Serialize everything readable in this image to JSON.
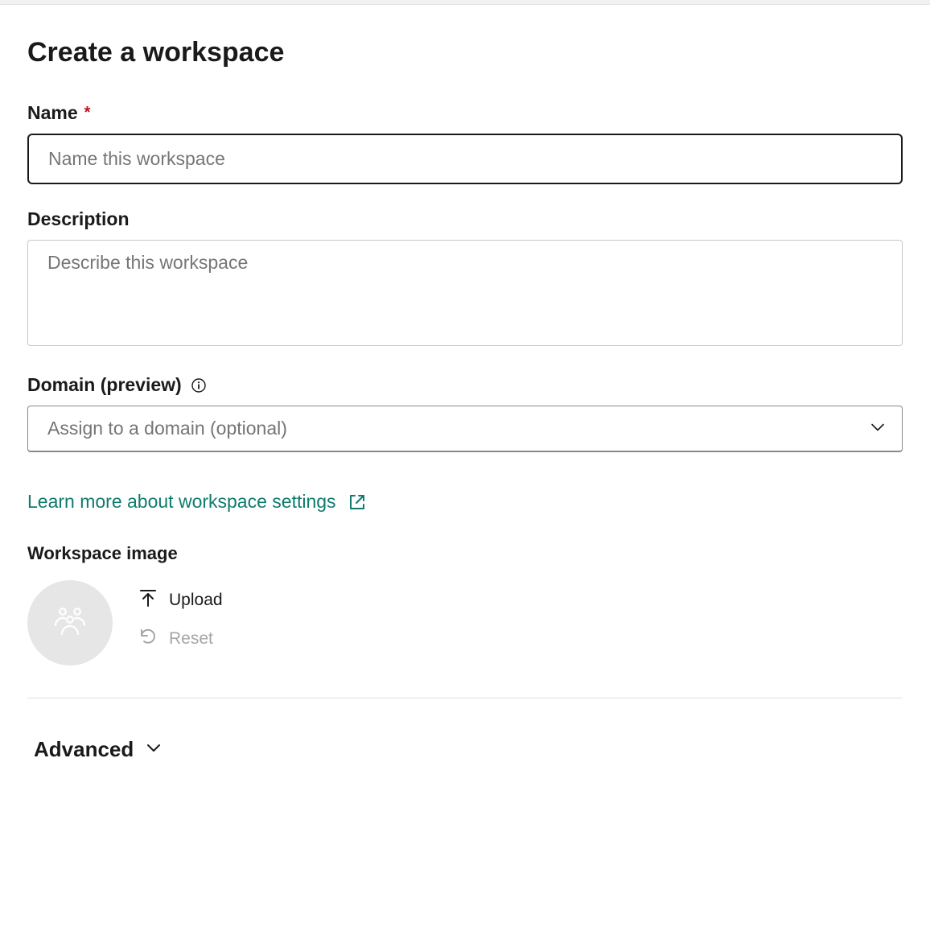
{
  "page_title": "Create a workspace",
  "fields": {
    "name": {
      "label": "Name",
      "required_indicator": "*",
      "placeholder": "Name this workspace",
      "value": ""
    },
    "description": {
      "label": "Description",
      "placeholder": "Describe this workspace",
      "value": ""
    },
    "domain": {
      "label": "Domain (preview)",
      "placeholder": "Assign to a domain (optional)",
      "value": ""
    }
  },
  "learn_more": {
    "text": "Learn more about workspace settings"
  },
  "workspace_image": {
    "label": "Workspace image",
    "upload_label": "Upload",
    "reset_label": "Reset"
  },
  "advanced": {
    "label": "Advanced"
  },
  "colors": {
    "link": "#0f7b6c",
    "required": "#c50f1f",
    "text": "#1a1a1a",
    "placeholder": "#767676",
    "disabled": "#a6a6a6"
  }
}
